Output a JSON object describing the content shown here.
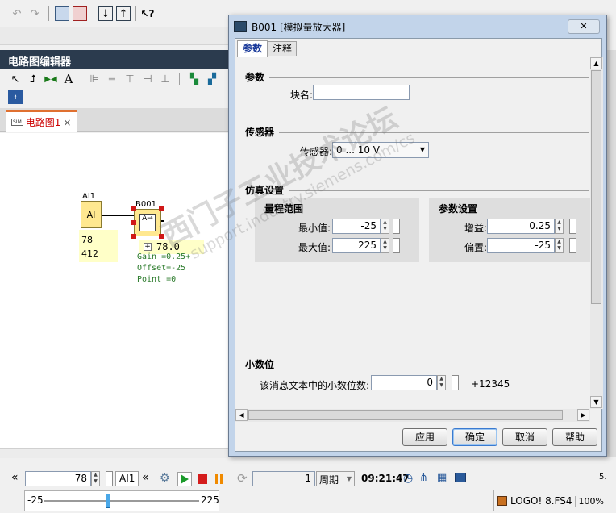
{
  "editor": {
    "title": "电路图编辑器",
    "tab_label": "电路图1",
    "tab_close": "×",
    "tab_icon_text": "SIM"
  },
  "circuit": {
    "ai_label": "AI1",
    "ai_text": "AI",
    "ai_value1": "78",
    "ai_value2": "412",
    "amp_label": "B001",
    "amp_text": "A→",
    "amp_value": "78.0",
    "amp_gain": "Gain =0.25+",
    "amp_offset": "Offset=-25",
    "amp_point": "Point =0",
    "plus": "+"
  },
  "dialog": {
    "title": "B001 [模拟量放大器]",
    "close": "✕",
    "tabs": [
      "参数",
      "注释"
    ],
    "sec_params": "参数",
    "block_name_label": "块名:",
    "block_name_value": "",
    "sec_sensor": "传感器",
    "sensor_label": "传感器:",
    "sensor_value": "0 ... 10 V",
    "sec_sim": "仿真设置",
    "range_title": "量程范围",
    "min_label": "最小值:",
    "min_value": "-25",
    "max_label": "最大值:",
    "max_value": "225",
    "param_title": "参数设置",
    "gain_label": "增益:",
    "gain_value": "0.25",
    "offset_label": "偏置:",
    "offset_value": "-25",
    "sec_decimal": "小数位",
    "decimal_label": "该消息文本中的小数位数:",
    "decimal_value": "0",
    "decimal_preview": "+12345",
    "buttons": {
      "apply": "应用",
      "ok": "确定",
      "cancel": "取消",
      "help": "帮助"
    }
  },
  "sim": {
    "chevron_left": "«",
    "value": "78",
    "channel": "AI1",
    "chevron2": "«",
    "cycle_value": "1",
    "cycle_label": "周期",
    "time": "09:21:47",
    "tail": "5.",
    "slider_min": "-25",
    "slider_max": "225",
    "slider_level": 0.41
  },
  "status": {
    "product": "LOGO! 8.FS4",
    "zoom": "100%"
  },
  "watermark": {
    "line1": "西门子工业技术论坛",
    "line2": "support.industry.siemens.com/cs"
  },
  "colors": {
    "accent_red": "#cc0000",
    "titlebar": "#2b3b4e",
    "play_green": "#1a9a2a",
    "pause_orange": "#f08a00",
    "stop_red": "#d41c1c"
  }
}
